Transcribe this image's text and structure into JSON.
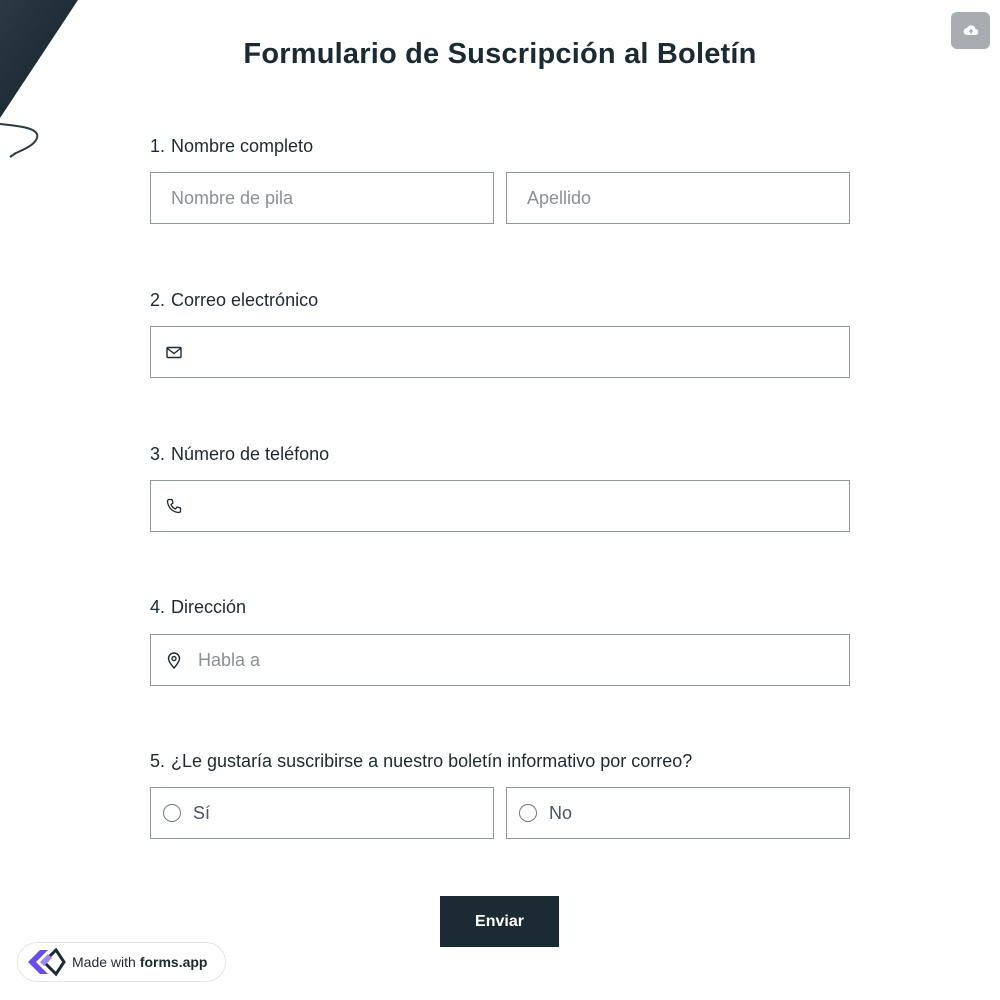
{
  "form": {
    "title": "Formulario de Suscripción al Boletín",
    "upload_icon": "cloud-upload-icon"
  },
  "questions": {
    "q1": {
      "number": "1.",
      "label": "Nombre completo",
      "first_name_placeholder": "Nombre de pila",
      "last_name_placeholder": "Apellido",
      "first_name_value": "",
      "last_name_value": ""
    },
    "q2": {
      "number": "2.",
      "label": "Correo electrónico",
      "icon": "envelope-icon",
      "value": "",
      "placeholder": ""
    },
    "q3": {
      "number": "3.",
      "label": "Número de teléfono",
      "icon": "phone-icon",
      "value": "",
      "placeholder": ""
    },
    "q4": {
      "number": "4.",
      "label": "Dirección",
      "icon": "map-pin-icon",
      "value": "",
      "placeholder": "Habla a"
    },
    "q5": {
      "number": "5.",
      "label": "¿Le gustaría suscribirse a nuestro boletín informativo por correo?",
      "options": [
        {
          "label": "Sí",
          "selected": false
        },
        {
          "label": "No",
          "selected": false
        }
      ]
    }
  },
  "submit": {
    "label": "Enviar"
  },
  "footer_badge": {
    "prefix": "Made with",
    "brand": "forms.app",
    "icon": "forms-app-logo"
  },
  "colors": {
    "primary": "#1c2a33",
    "border": "#8f989d",
    "upload_button": "#a7adb1",
    "logo_purple": "#6c4cf1"
  }
}
